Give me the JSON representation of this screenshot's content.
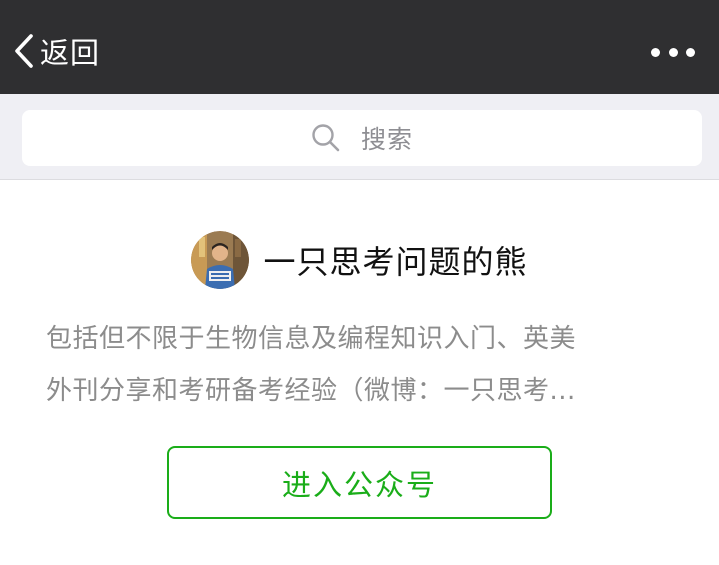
{
  "navbar": {
    "back_label": "返回",
    "back_icon": "chevron-left-icon",
    "more_icon": "more-dots-icon",
    "background": "#2f2f31"
  },
  "search": {
    "placeholder": "搜索",
    "icon": "search-icon"
  },
  "account": {
    "name": "一只思考问题的熊",
    "description_lines": [
      "包括但不限于生物信息及编程知识入门、英美",
      "外刊分享和考研备考经验（微博：一只思考..."
    ],
    "enter_button_label": "进入公众号",
    "accent_color": "#1aad19"
  }
}
